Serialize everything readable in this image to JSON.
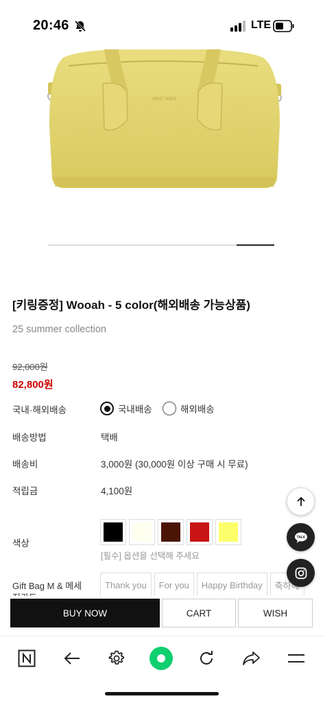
{
  "status": {
    "time": "20:46",
    "network": "LTE"
  },
  "product": {
    "title": "[키링증정] Wooah - 5 color(해외배송 가능상품)",
    "subtitle": "25 summer collection",
    "original_price": "92,000원",
    "sale_price": "82,800원",
    "brand_mark": "MAC NIBO"
  },
  "info": {
    "shipping_region_label": "국내·해외배송",
    "domestic_label": "국내배송",
    "overseas_label": "해외배송",
    "method_label": "배송방법",
    "method_value": "택배",
    "fee_label": "배송비",
    "fee_value": "3,000원 (30,000원 이상 구매 시 무료)",
    "points_label": "적립금",
    "points_value": "4,100원",
    "color_label": "색상",
    "colors": [
      "#000000",
      "#fffff0",
      "#4a1505",
      "#c81414",
      "#fcff6a"
    ],
    "color_hint": "[필수] 옵션을 선택해 주세요",
    "gift_label": "Gift Bag M & 메세지카드",
    "gift_options": [
      "Thank you",
      "For you",
      "Happy Birthday",
      "축하해"
    ]
  },
  "actions": {
    "buy": "BUY NOW",
    "cart": "CART",
    "wish": "WISH"
  },
  "fab": {
    "talk": "TALK"
  }
}
